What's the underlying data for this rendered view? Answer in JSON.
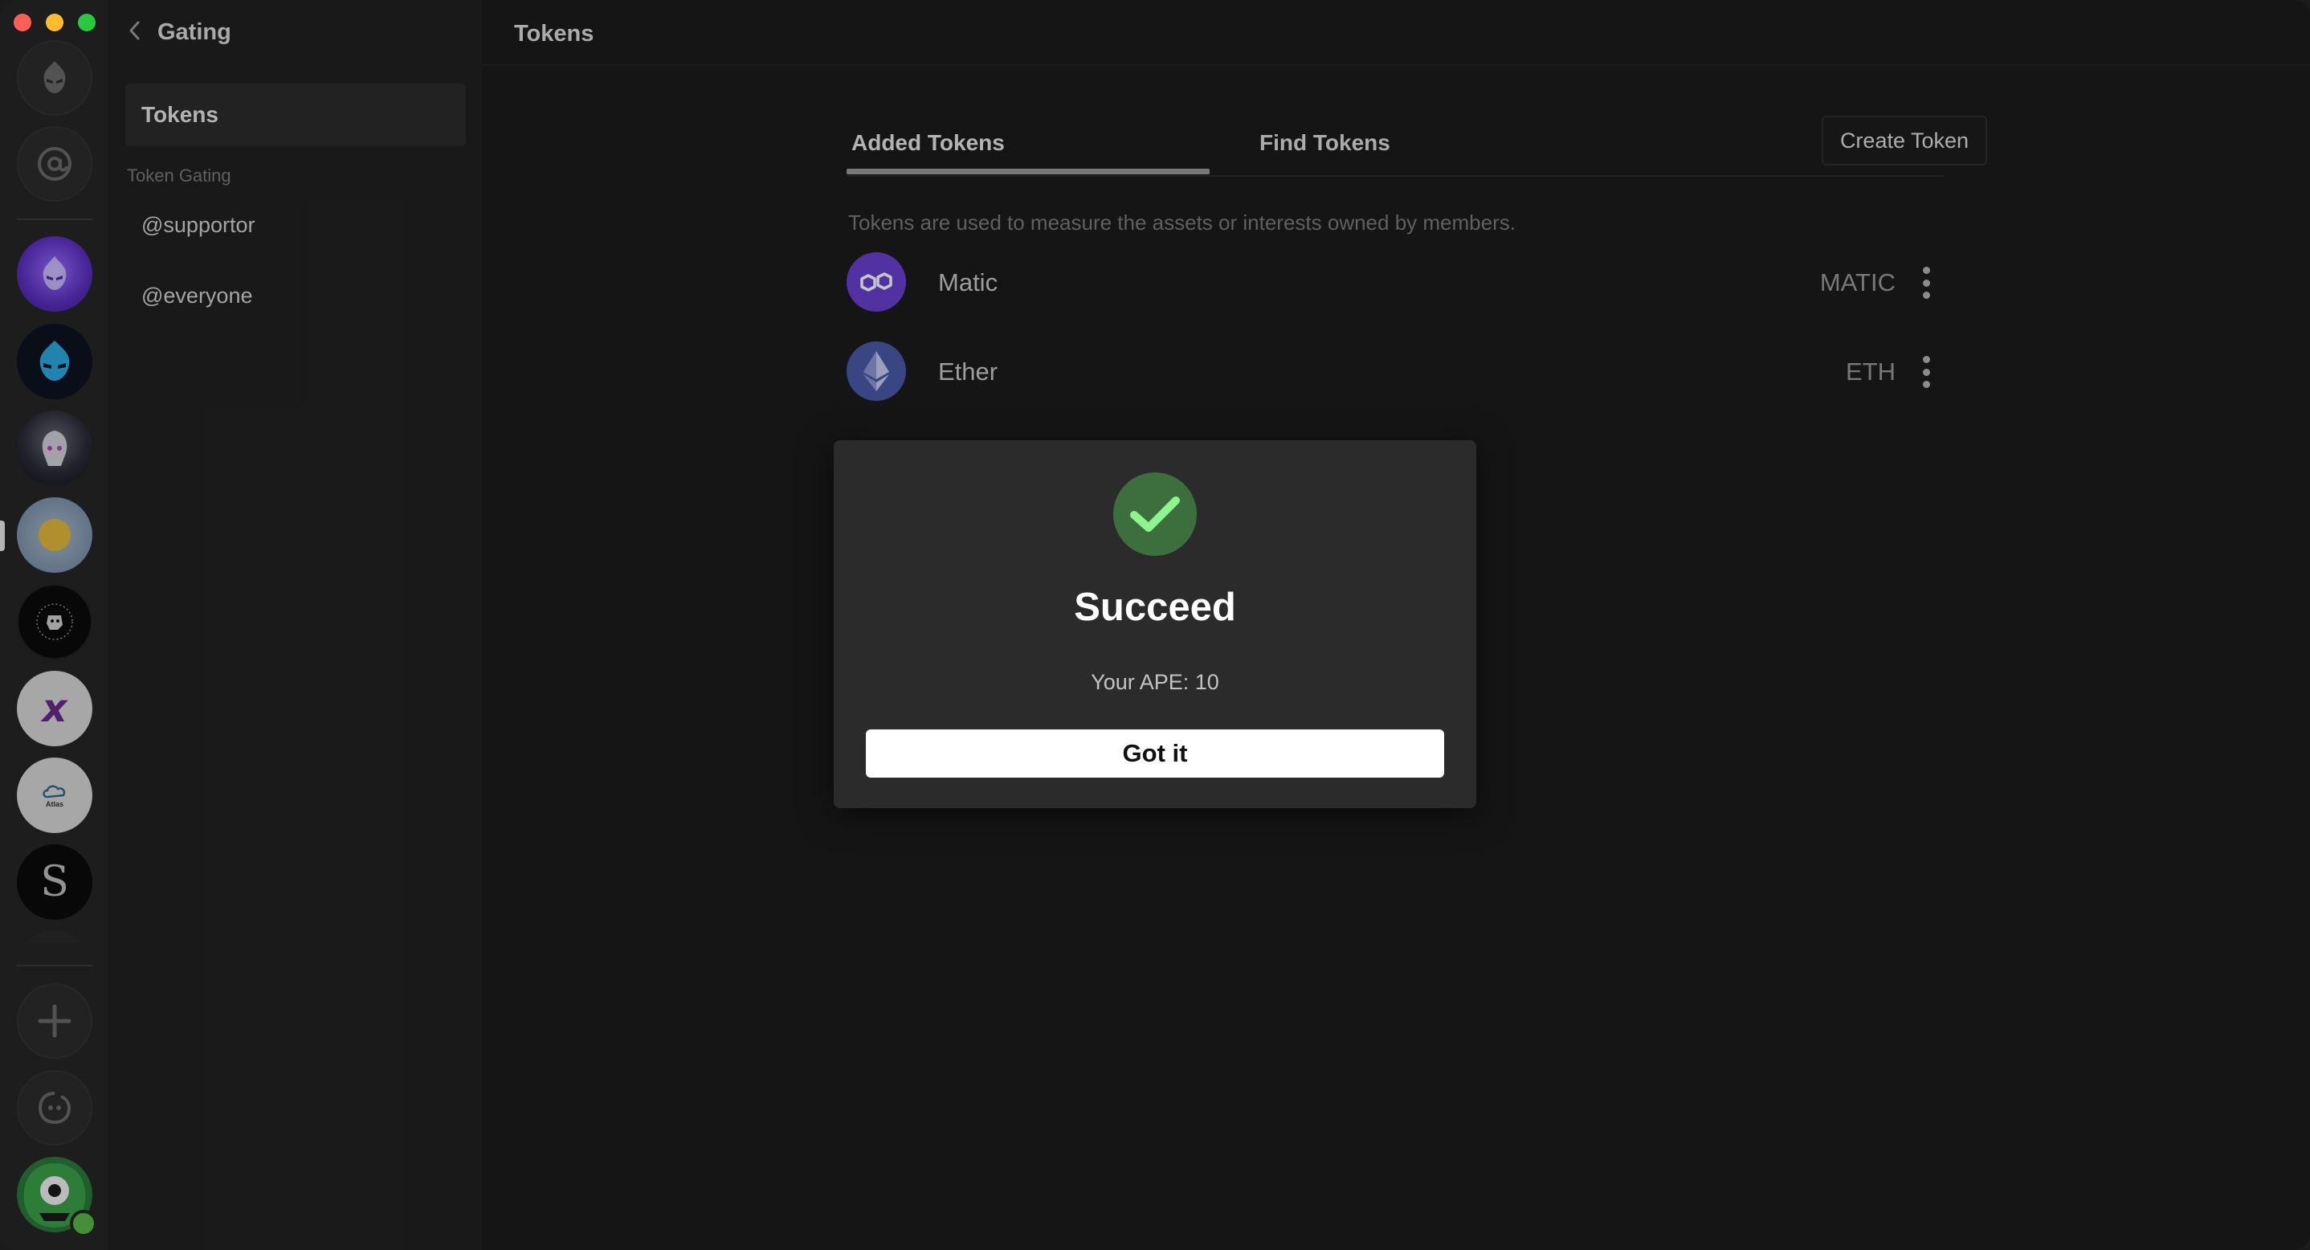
{
  "sidebar": {
    "back_label": "Gating",
    "active_item": "Tokens",
    "section_label": "Token Gating",
    "roles": [
      "@supportor",
      "@everyone"
    ]
  },
  "main": {
    "title": "Tokens",
    "tabs": [
      {
        "label": "Added Tokens",
        "active": true
      },
      {
        "label": "Find Tokens",
        "active": false
      }
    ],
    "create_button": "Create Token",
    "description": "Tokens are used to measure the assets or interests owned by members.",
    "tokens": [
      {
        "name": "Matic",
        "symbol": "MATIC",
        "icon": "polygon-icon",
        "color": "#6a3fd0"
      },
      {
        "name": "Ether",
        "symbol": "ETH",
        "icon": "ethereum-icon",
        "color": "#4a5aa8"
      }
    ]
  },
  "modal": {
    "title": "Succeed",
    "message": "Your APE: 10",
    "button": "Got it",
    "icon": "check-icon"
  },
  "rail": {
    "icons": [
      "app-logo-icon",
      "mentions-icon",
      "server-avatar",
      "server-avatar",
      "server-avatar",
      "server-avatar",
      "server-avatar",
      "server-avatar",
      "server-avatar",
      "server-avatar",
      "add-server-icon",
      "explore-icon",
      "user-avatar"
    ],
    "server_letters": {
      "x": "x",
      "s": "S",
      "atlas": "Atlas"
    }
  },
  "colors": {
    "success": "#3d6e3d",
    "check": "#8ef58e",
    "online": "#57b847"
  }
}
